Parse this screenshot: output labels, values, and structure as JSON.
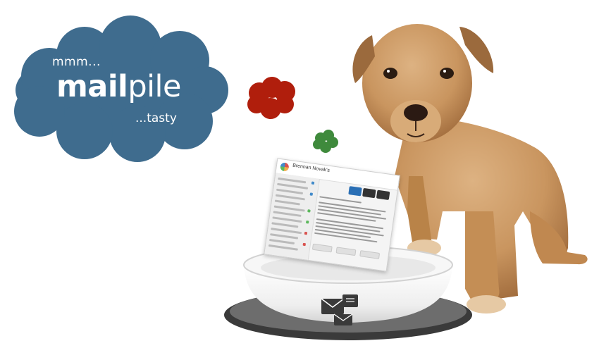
{
  "thought_cloud": {
    "line1": "mmm...",
    "brand_bold": "mail",
    "brand_regular": "pile",
    "line3": "...tasty",
    "fill_color": "#3f6c8e",
    "text_color": "#ffffff"
  },
  "small_clouds": {
    "red_color": "#b01e0c",
    "green_color": "#3f8a3c"
  },
  "screenshot_card": {
    "title": "Brennan Novak's"
  },
  "bowl": {
    "icon": "envelopes-icon",
    "rim_color": "#3a3a3a"
  },
  "puppy": {
    "fur_color": "#c9955f"
  }
}
